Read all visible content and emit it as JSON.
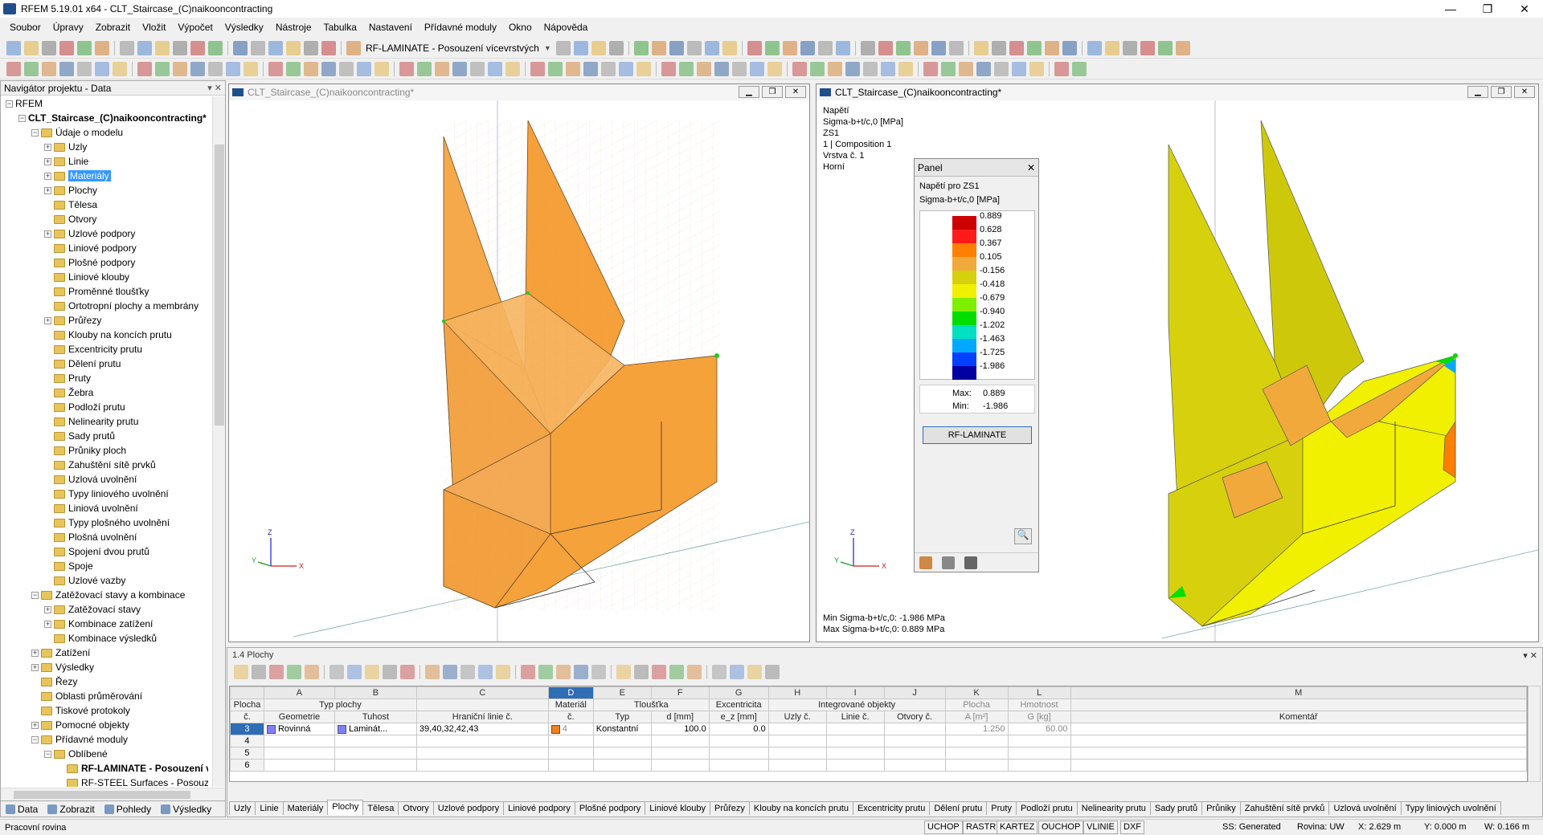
{
  "window": {
    "title": "RFEM 5.19.01 x64 - CLT_Staircase_(C)naikooncontracting",
    "controls": [
      "—",
      "❐",
      "✕"
    ]
  },
  "menu": [
    "Soubor",
    "Úpravy",
    "Zobrazit",
    "Vložit",
    "Výpočet",
    "Výsledky",
    "Nástroje",
    "Tabulka",
    "Nastavení",
    "Přídavné moduly",
    "Okno",
    "Nápověda"
  ],
  "toolbar": {
    "module_select": "RF-LAMINATE - Posouzení vícevrstvých"
  },
  "navigator": {
    "title": "Navigátor projektu - Data",
    "items": [
      {
        "label": "RFEM",
        "level": 0,
        "exp": "−",
        "icon": false,
        "bold": false
      },
      {
        "label": "CLT_Staircase_(C)naikooncontracting*",
        "level": 1,
        "exp": "−",
        "icon": false,
        "bold": true
      },
      {
        "label": "Údaje o modelu",
        "level": 2,
        "exp": "−",
        "icon": true
      },
      {
        "label": "Uzly",
        "level": 3,
        "exp": "+",
        "icon": true
      },
      {
        "label": "Linie",
        "level": 3,
        "exp": "+",
        "icon": true
      },
      {
        "label": "Materiály",
        "level": 3,
        "exp": "+",
        "icon": true,
        "selected": true
      },
      {
        "label": "Plochy",
        "level": 3,
        "exp": "+",
        "icon": true
      },
      {
        "label": "Tělesa",
        "level": 3,
        "exp": "",
        "icon": true
      },
      {
        "label": "Otvory",
        "level": 3,
        "exp": "",
        "icon": true
      },
      {
        "label": "Uzlové podpory",
        "level": 3,
        "exp": "+",
        "icon": true
      },
      {
        "label": "Liniové podpory",
        "level": 3,
        "exp": "",
        "icon": true
      },
      {
        "label": "Plošné podpory",
        "level": 3,
        "exp": "",
        "icon": true
      },
      {
        "label": "Liniové klouby",
        "level": 3,
        "exp": "",
        "icon": true
      },
      {
        "label": "Proměnné tloušťky",
        "level": 3,
        "exp": "",
        "icon": true
      },
      {
        "label": "Ortotropní plochy a membrány",
        "level": 3,
        "exp": "",
        "icon": true
      },
      {
        "label": "Průřezy",
        "level": 3,
        "exp": "+",
        "icon": true
      },
      {
        "label": "Klouby na koncích prutu",
        "level": 3,
        "exp": "",
        "icon": true
      },
      {
        "label": "Excentricity prutu",
        "level": 3,
        "exp": "",
        "icon": true
      },
      {
        "label": "Dělení prutu",
        "level": 3,
        "exp": "",
        "icon": true
      },
      {
        "label": "Pruty",
        "level": 3,
        "exp": "",
        "icon": true
      },
      {
        "label": "Žebra",
        "level": 3,
        "exp": "",
        "icon": true
      },
      {
        "label": "Podloží prutu",
        "level": 3,
        "exp": "",
        "icon": true
      },
      {
        "label": "Nelinearity prutu",
        "level": 3,
        "exp": "",
        "icon": true
      },
      {
        "label": "Sady prutů",
        "level": 3,
        "exp": "",
        "icon": true
      },
      {
        "label": "Průniky ploch",
        "level": 3,
        "exp": "",
        "icon": true
      },
      {
        "label": "Zahuštění sítě prvků",
        "level": 3,
        "exp": "",
        "icon": true
      },
      {
        "label": "Uzlová uvolnění",
        "level": 3,
        "exp": "",
        "icon": true
      },
      {
        "label": "Typy liniového uvolnění",
        "level": 3,
        "exp": "",
        "icon": true
      },
      {
        "label": "Liniová uvolnění",
        "level": 3,
        "exp": "",
        "icon": true
      },
      {
        "label": "Typy plošného uvolnění",
        "level": 3,
        "exp": "",
        "icon": true
      },
      {
        "label": "Plošná uvolnění",
        "level": 3,
        "exp": "",
        "icon": true
      },
      {
        "label": "Spojení dvou prutů",
        "level": 3,
        "exp": "",
        "icon": true
      },
      {
        "label": "Spoje",
        "level": 3,
        "exp": "",
        "icon": true
      },
      {
        "label": "Uzlové vazby",
        "level": 3,
        "exp": "",
        "icon": true
      },
      {
        "label": "Zatěžovací stavy a kombinace",
        "level": 2,
        "exp": "−",
        "icon": true
      },
      {
        "label": "Zatěžovací stavy",
        "level": 3,
        "exp": "+",
        "icon": true
      },
      {
        "label": "Kombinace zatížení",
        "level": 3,
        "exp": "+",
        "icon": true
      },
      {
        "label": "Kombinace výsledků",
        "level": 3,
        "exp": "",
        "icon": true
      },
      {
        "label": "Zatížení",
        "level": 2,
        "exp": "+",
        "icon": true
      },
      {
        "label": "Výsledky",
        "level": 2,
        "exp": "+",
        "icon": true
      },
      {
        "label": "Řezy",
        "level": 2,
        "exp": "",
        "icon": true
      },
      {
        "label": "Oblasti průměrování",
        "level": 2,
        "exp": "",
        "icon": true
      },
      {
        "label": "Tiskové protokoly",
        "level": 2,
        "exp": "",
        "icon": true
      },
      {
        "label": "Pomocné objekty",
        "level": 2,
        "exp": "+",
        "icon": true
      },
      {
        "label": "Přídavné moduly",
        "level": 2,
        "exp": "−",
        "icon": true
      },
      {
        "label": "Oblíbené",
        "level": 3,
        "exp": "−",
        "icon": true
      },
      {
        "label": "RF-LAMINATE - Posouzení v",
        "level": 4,
        "exp": "",
        "icon": true,
        "bold": true
      },
      {
        "label": "RF-STEEL Surfaces - Posouz",
        "level": 4,
        "exp": "",
        "icon": true
      }
    ],
    "tabs": [
      "Data",
      "Zobrazit",
      "Pohledy",
      "Výsledky"
    ]
  },
  "viewport1": {
    "title": "CLT_Staircase_(C)naikooncontracting*"
  },
  "viewport2": {
    "title": "CLT_Staircase_(C)naikooncontracting*",
    "info": [
      "Napětí",
      "Sigma-b+t/c,0 [MPa]",
      "ZS1",
      "1 | Composition 1",
      "Vrstva č. 1",
      "Horní"
    ],
    "result": [
      "Min Sigma-b+t/c,0: -1.986 MPa",
      "Max Sigma-b+t/c,0: 0.889 MPa"
    ]
  },
  "axes": {
    "x": "X",
    "y": "Y",
    "z": "Z"
  },
  "panel": {
    "title": "Panel",
    "close": "✕",
    "line1": "Napětí pro ZS1",
    "line2": "Sigma-b+t/c,0 [MPa]",
    "legend": [
      {
        "value": "0.889",
        "color": "#cc0000"
      },
      {
        "value": "0.628",
        "color": "#ff1a1a"
      },
      {
        "value": "0.367",
        "color": "#ff7f00"
      },
      {
        "value": "0.105",
        "color": "#f2a93b"
      },
      {
        "value": "-0.156",
        "color": "#d6d10c"
      },
      {
        "value": "-0.418",
        "color": "#f0f000"
      },
      {
        "value": "-0.679",
        "color": "#7cf000"
      },
      {
        "value": "-0.940",
        "color": "#00dd00"
      },
      {
        "value": "-1.202",
        "color": "#00e0c0"
      },
      {
        "value": "-1.463",
        "color": "#00a8ff"
      },
      {
        "value": "-1.725",
        "color": "#0040ff"
      },
      {
        "value": "-1.986",
        "color": "#0000a0"
      }
    ],
    "max_label": "Max:",
    "max_value": "0.889",
    "min_label": "Min:",
    "min_value": "-1.986",
    "button": "RF-LAMINATE"
  },
  "table": {
    "title": "1.4 Plochy",
    "letters": [
      "",
      "A",
      "B",
      "C",
      "D",
      "E",
      "F",
      "G",
      "H",
      "I",
      "J",
      "K",
      "L",
      "M"
    ],
    "header1": [
      "Plocha",
      "Typ plochy",
      "Materiál",
      "Tloušťka",
      "Excentricita",
      "Integrované objekty",
      "Plocha",
      "Hmotnost"
    ],
    "header2": [
      "č.",
      "Geometrie",
      "Tuhost",
      "Hraniční linie č.",
      "č.",
      "Typ",
      "d [mm]",
      "e_z [mm]",
      "Uzly č.",
      "Linie č.",
      "Otvory č.",
      "A [m²]",
      "G [kg]",
      "Komentář"
    ],
    "row": {
      "no": "3",
      "geometry": "Rovinná",
      "stiffness": "Laminát...",
      "lines": "39,40,32,42,43",
      "material": "4",
      "type": "Konstantní",
      "d": "100.0",
      "ez": "0.0",
      "area": "1.250",
      "weight": "60.00"
    },
    "empty_rows": [
      "4",
      "5",
      "6"
    ],
    "tabs": [
      "Uzly",
      "Linie",
      "Materiály",
      "Plochy",
      "Tělesa",
      "Otvory",
      "Uzlové podpory",
      "Liniové podpory",
      "Plošné podpory",
      "Liniové klouby",
      "Průřezy",
      "Klouby na koncích prutu",
      "Excentricity prutu",
      "Dělení prutu",
      "Pruty",
      "Podloží prutu",
      "Nelinearity prutu",
      "Sady prutů",
      "Průniky",
      "Zahuštění sítě prvků",
      "Uzlová uvolnění",
      "Typy liniových uvolnění"
    ],
    "active_tab": "Plochy"
  },
  "status": {
    "left": "Pracovní rovina",
    "buttons": [
      "UCHOP",
      "RASTR",
      "KARTEZ",
      "OUCHOP",
      "VLINIE",
      "DXF"
    ],
    "ss": "SS: Generated",
    "plane": "Rovina: UW",
    "x": "X: 2.629 m",
    "y": "Y: 0.000 m",
    "z": "W: 0.166 m"
  }
}
